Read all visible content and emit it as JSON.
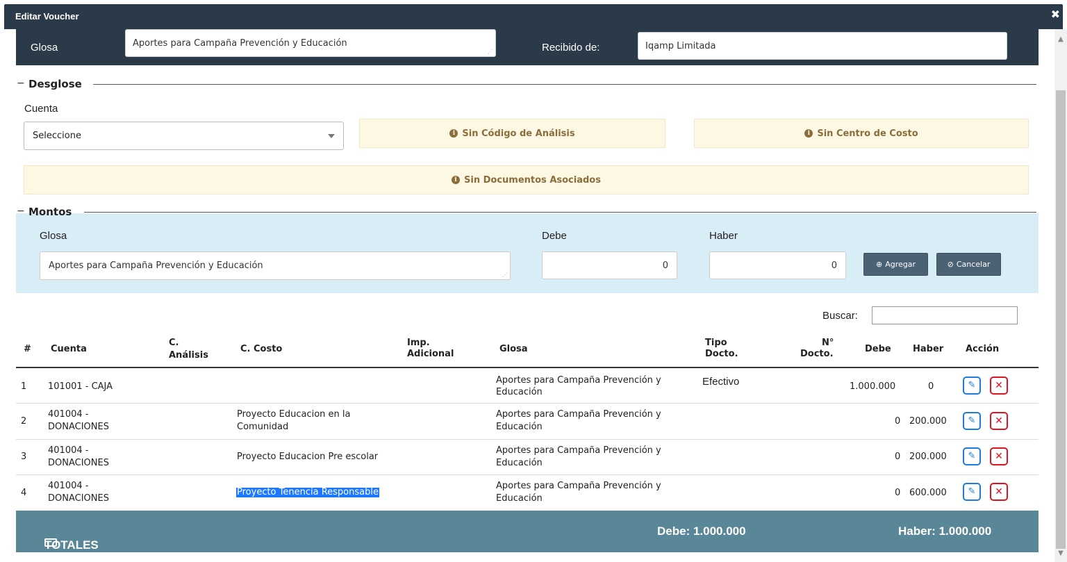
{
  "window": {
    "title": "Editar Voucher",
    "close_glyph": "✖"
  },
  "header": {
    "glosa_label": "Glosa",
    "glosa_value": "Aportes para Campaña Prevención y Educación",
    "recibido_label": "Recibido de:",
    "recibido_value": "Iqamp Limitada"
  },
  "desglose": {
    "title": "Desglose",
    "cuenta_label": "Cuenta",
    "cuenta_value": "Seleccione",
    "warn_codigo": "Sin Código de Análisis",
    "warn_centro": "Sin Centro de Costo",
    "warn_documentos": "Sin Documentos Asociados"
  },
  "montos": {
    "title": "Montos",
    "glosa_label": "Glosa",
    "glosa_value": "Aportes para Campaña Prevención y Educación",
    "debe_label": "Debe",
    "debe_value": "0",
    "haber_label": "Haber",
    "haber_value": "0",
    "agregar_label": "Agregar",
    "cancelar_label": "Cancelar"
  },
  "search": {
    "label": "Buscar:",
    "value": ""
  },
  "table": {
    "headers": {
      "num": "#",
      "cuenta": "Cuenta",
      "c_analisis_1": "C.",
      "c_analisis_2": "Análisis",
      "c_costo": "C. Costo",
      "imp_1": "Imp.",
      "imp_2": "Adicional",
      "glosa": "Glosa",
      "tipo_1": "Tipo",
      "tipo_2": "Docto.",
      "ndoc_1": "N°",
      "ndoc_2": "Docto.",
      "debe": "Debe",
      "haber": "Haber",
      "accion": "Acción"
    },
    "rows": [
      {
        "num": "1",
        "cuenta_1": "101001 - CAJA",
        "cuenta_2": "",
        "costo_1": "",
        "costo_2": "",
        "glosa_1": "Aportes para Campaña Prevención y",
        "glosa_2": "Educación",
        "tipo": "Efectivo",
        "debe": "1.000.000",
        "haber": "0"
      },
      {
        "num": "2",
        "cuenta_1": "401004 -",
        "cuenta_2": "DONACIONES",
        "costo_1": "Proyecto Educacion en la",
        "costo_2": "Comunidad",
        "glosa_1": "Aportes para Campaña Prevención y",
        "glosa_2": "Educación",
        "tipo": "",
        "debe": "0",
        "haber": "200.000"
      },
      {
        "num": "3",
        "cuenta_1": "401004 -",
        "cuenta_2": "DONACIONES",
        "costo_1": "Proyecto Educacion Pre escolar",
        "costo_2": "",
        "glosa_1": "Aportes para Campaña Prevención y",
        "glosa_2": "Educación",
        "tipo": "",
        "debe": "0",
        "haber": "200.000"
      },
      {
        "num": "4",
        "cuenta_1": "401004 -",
        "cuenta_2": "DONACIONES",
        "costo_1": "Proyecto Tenencia Responsable",
        "costo_2": "",
        "glosa_1": "Aportes para Campaña Prevención y",
        "glosa_2": "Educación",
        "tipo": "",
        "debe": "0",
        "haber": "600.000"
      }
    ]
  },
  "totals": {
    "label": "TOTALES",
    "debe": "Debe: 1.000.000",
    "haber": "Haber: 1.000.000"
  },
  "colors": {
    "header_bg": "#2b3a48",
    "warning_bg": "#fcf8e3",
    "montos_bg": "#d9edf7",
    "totals_bg": "#5a8797",
    "edit_icon": "#1a7dd8",
    "delete_icon": "#e0141e"
  },
  "icons": {
    "close": "close-icon",
    "info": "info-circle-icon",
    "plus": "plus-circle-icon",
    "cancel": "ban-icon",
    "edit": "pencil-icon",
    "delete": "times-icon",
    "money": "money-icon"
  }
}
